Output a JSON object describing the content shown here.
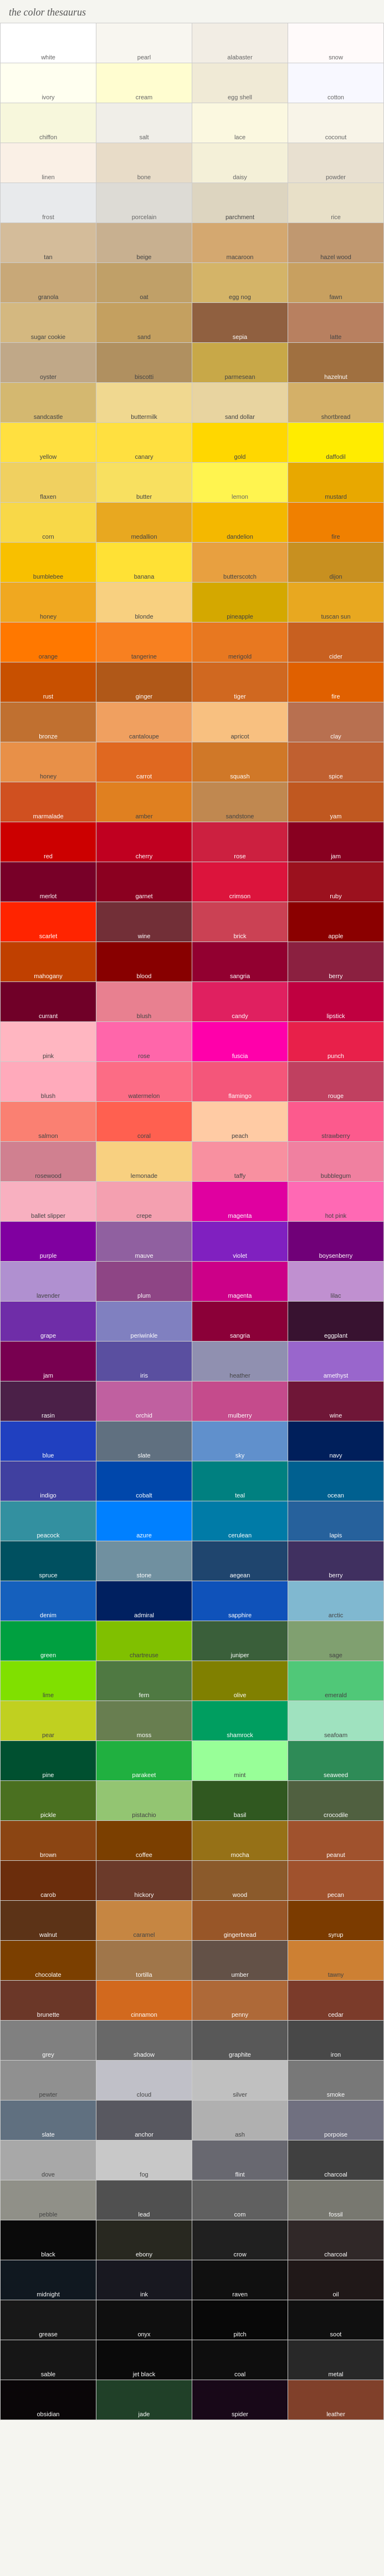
{
  "title": "the color thesaurus",
  "colors": [
    {
      "label": "white",
      "hex": "#FFFFFF"
    },
    {
      "label": "pearl",
      "hex": "#F8F6F0"
    },
    {
      "label": "alabaster",
      "hex": "#F2EDE4"
    },
    {
      "label": "snow",
      "hex": "#FFFAFA"
    },
    {
      "label": "ivory",
      "hex": "#FFFFF0"
    },
    {
      "label": "cream",
      "hex": "#FFFDD0"
    },
    {
      "label": "egg shell",
      "hex": "#F0EAD6"
    },
    {
      "label": "cotton",
      "hex": "#F8F8FF"
    },
    {
      "label": "chiffon",
      "hex": "#F7F7DC"
    },
    {
      "label": "salt",
      "hex": "#F0EEE8"
    },
    {
      "label": "lace",
      "hex": "#FBF8E0"
    },
    {
      "label": "coconut",
      "hex": "#F8F4E8"
    },
    {
      "label": "linen",
      "hex": "#FAF0E6"
    },
    {
      "label": "bone",
      "hex": "#E8DCC8"
    },
    {
      "label": "daisy",
      "hex": "#F4F0D8"
    },
    {
      "label": "powder",
      "hex": "#E8E0D0"
    },
    {
      "label": "frost",
      "hex": "#E8EAEC"
    },
    {
      "label": "porcelain",
      "hex": "#DDDBD5"
    },
    {
      "label": "parchment",
      "hex": "#DDD5C0"
    },
    {
      "label": "rice",
      "hex": "#E8E0C8"
    },
    {
      "label": "tan",
      "hex": "#D4BC9A"
    },
    {
      "label": "beige",
      "hex": "#C8B090"
    },
    {
      "label": "macaroon",
      "hex": "#D4A870"
    },
    {
      "label": "hazel wood",
      "hex": "#C09870"
    },
    {
      "label": "granola",
      "hex": "#C8A878"
    },
    {
      "label": "oat",
      "hex": "#C0A068"
    },
    {
      "label": "egg nog",
      "hex": "#D4B468"
    },
    {
      "label": "fawn",
      "hex": "#C8A060"
    },
    {
      "label": "sugar cookie",
      "hex": "#D4B880"
    },
    {
      "label": "sand",
      "hex": "#C4A060"
    },
    {
      "label": "sepia",
      "hex": "#906040"
    },
    {
      "label": "latte",
      "hex": "#B88060"
    },
    {
      "label": "oyster",
      "hex": "#C0A888"
    },
    {
      "label": "biscotti",
      "hex": "#B09060"
    },
    {
      "label": "parmesean",
      "hex": "#C8A848"
    },
    {
      "label": "hazelnut",
      "hex": "#A07040"
    },
    {
      "label": "sandcastle",
      "hex": "#D4B870"
    },
    {
      "label": "buttermilk",
      "hex": "#F0D890"
    },
    {
      "label": "sand dollar",
      "hex": "#E8D4A0"
    },
    {
      "label": "shortbread",
      "hex": "#D4B068"
    },
    {
      "label": "yellow",
      "hex": "#FFE040"
    },
    {
      "label": "canary",
      "hex": "#FFE040"
    },
    {
      "label": "gold",
      "hex": "#FFD700"
    },
    {
      "label": "daffodil",
      "hex": "#FFEC00"
    },
    {
      "label": "flaxen",
      "hex": "#F0D060"
    },
    {
      "label": "butter",
      "hex": "#F8E060"
    },
    {
      "label": "lemon",
      "hex": "#FFF44F"
    },
    {
      "label": "mustard",
      "hex": "#E8A800"
    },
    {
      "label": "corn",
      "hex": "#F8D848"
    },
    {
      "label": "medallion",
      "hex": "#E8A820"
    },
    {
      "label": "dandelion",
      "hex": "#F4B800"
    },
    {
      "label": "fire",
      "hex": "#F08000"
    },
    {
      "label": "bumblebee",
      "hex": "#F8C000"
    },
    {
      "label": "banana",
      "hex": "#FFE135"
    },
    {
      "label": "butterscotch",
      "hex": "#E8A040"
    },
    {
      "label": "dijon",
      "hex": "#C89020"
    },
    {
      "label": "honey",
      "hex": "#F0A820"
    },
    {
      "label": "blonde",
      "hex": "#F8D080"
    },
    {
      "label": "pineapple",
      "hex": "#D4A800"
    },
    {
      "label": "tuscan sun",
      "hex": "#E8A820"
    },
    {
      "label": "orange",
      "hex": "#FF7800"
    },
    {
      "label": "tangerine",
      "hex": "#F88020"
    },
    {
      "label": "merigold",
      "hex": "#E87820"
    },
    {
      "label": "cider",
      "hex": "#C86020"
    },
    {
      "label": "rust",
      "hex": "#C85000"
    },
    {
      "label": "ginger",
      "hex": "#B05818"
    },
    {
      "label": "tiger",
      "hex": "#D06820"
    },
    {
      "label": "fire",
      "hex": "#E06000"
    },
    {
      "label": "bronze",
      "hex": "#C07030"
    },
    {
      "label": "cantaloupe",
      "hex": "#F0A060"
    },
    {
      "label": "apricot",
      "hex": "#F8C080"
    },
    {
      "label": "clay",
      "hex": "#B87050"
    },
    {
      "label": "honey",
      "hex": "#E89048"
    },
    {
      "label": "carrot",
      "hex": "#E06820"
    },
    {
      "label": "squash",
      "hex": "#D07828"
    },
    {
      "label": "spice",
      "hex": "#C06030"
    },
    {
      "label": "marmalade",
      "hex": "#D05020"
    },
    {
      "label": "amber",
      "hex": "#E08020"
    },
    {
      "label": "sandstone",
      "hex": "#C08850"
    },
    {
      "label": "yam",
      "hex": "#C05820"
    },
    {
      "label": "red",
      "hex": "#CC0000"
    },
    {
      "label": "cherry",
      "hex": "#C00020"
    },
    {
      "label": "rose",
      "hex": "#CC2040"
    },
    {
      "label": "jam",
      "hex": "#880020"
    },
    {
      "label": "merlot",
      "hex": "#780028"
    },
    {
      "label": "garnet",
      "hex": "#8B0020"
    },
    {
      "label": "crimson",
      "hex": "#DC143C"
    },
    {
      "label": "ruby",
      "hex": "#9B111E"
    },
    {
      "label": "scarlet",
      "hex": "#FF2400"
    },
    {
      "label": "wine",
      "hex": "#722F37"
    },
    {
      "label": "brick",
      "hex": "#CB4154"
    },
    {
      "label": "apple",
      "hex": "#8B0000"
    },
    {
      "label": "mahogany",
      "hex": "#C04000"
    },
    {
      "label": "blood",
      "hex": "#880000"
    },
    {
      "label": "sangria",
      "hex": "#920030"
    },
    {
      "label": "berry",
      "hex": "#8B2040"
    },
    {
      "label": "currant",
      "hex": "#700028"
    },
    {
      "label": "blush",
      "hex": "#E88090"
    },
    {
      "label": "candy",
      "hex": "#E02060"
    },
    {
      "label": "lipstick",
      "hex": "#C00040"
    },
    {
      "label": "pink",
      "hex": "#FFB6C1"
    },
    {
      "label": "rose",
      "hex": "#FF66AA"
    },
    {
      "label": "fuscia",
      "hex": "#FF00AA"
    },
    {
      "label": "punch",
      "hex": "#E8204A"
    },
    {
      "label": "blush",
      "hex": "#FFAABB"
    },
    {
      "label": "watermelon",
      "hex": "#FC6C85"
    },
    {
      "label": "flamingo",
      "hex": "#F4567A"
    },
    {
      "label": "rouge",
      "hex": "#C04060"
    },
    {
      "label": "salmon",
      "hex": "#FA8072"
    },
    {
      "label": "coral",
      "hex": "#FF6050"
    },
    {
      "label": "peach",
      "hex": "#FFCBA4"
    },
    {
      "label": "strawberry",
      "hex": "#FC5A8D"
    },
    {
      "label": "rosewood",
      "hex": "#D08090"
    },
    {
      "label": "lemonade",
      "hex": "#F8D080"
    },
    {
      "label": "taffy",
      "hex": "#F890A0"
    },
    {
      "label": "bubblegum",
      "hex": "#F080A0"
    },
    {
      "label": "ballet slipper",
      "hex": "#F8B0C0"
    },
    {
      "label": "crepe",
      "hex": "#F4A0B0"
    },
    {
      "label": "magenta",
      "hex": "#E000A0"
    },
    {
      "label": "hot pink",
      "hex": "#FF69B4"
    },
    {
      "label": "purple",
      "hex": "#8000A0"
    },
    {
      "label": "mauve",
      "hex": "#9060A0"
    },
    {
      "label": "violet",
      "hex": "#8020C0"
    },
    {
      "label": "boysenberry",
      "hex": "#700078"
    },
    {
      "label": "lavender",
      "hex": "#B090D0"
    },
    {
      "label": "plum",
      "hex": "#8E4585"
    },
    {
      "label": "magenta",
      "hex": "#CC0088"
    },
    {
      "label": "lilac",
      "hex": "#C090D0"
    },
    {
      "label": "grape",
      "hex": "#6F2DA8"
    },
    {
      "label": "periwinkle",
      "hex": "#8080C0"
    },
    {
      "label": "sangria",
      "hex": "#8B0038"
    },
    {
      "label": "eggplant",
      "hex": "#381230"
    },
    {
      "label": "jam",
      "hex": "#780050"
    },
    {
      "label": "iris",
      "hex": "#5A4FA0"
    },
    {
      "label": "heather",
      "hex": "#9090B0"
    },
    {
      "label": "amethyst",
      "hex": "#9966CC"
    },
    {
      "label": "rasin",
      "hex": "#4B2048"
    },
    {
      "label": "orchid",
      "hex": "#C060A0"
    },
    {
      "label": "mulberry",
      "hex": "#C54B8C"
    },
    {
      "label": "wine",
      "hex": "#6F1637"
    },
    {
      "label": "blue",
      "hex": "#2040C0"
    },
    {
      "label": "slate",
      "hex": "#607080"
    },
    {
      "label": "sky",
      "hex": "#6090CC"
    },
    {
      "label": "navy",
      "hex": "#001F5B"
    },
    {
      "label": "indigo",
      "hex": "#4040A0"
    },
    {
      "label": "cobalt",
      "hex": "#0047AB"
    },
    {
      "label": "teal",
      "hex": "#008080"
    },
    {
      "label": "ocean",
      "hex": "#006090"
    },
    {
      "label": "peacock",
      "hex": "#3390A0"
    },
    {
      "label": "azure",
      "hex": "#0080FF"
    },
    {
      "label": "cerulean",
      "hex": "#007BA7"
    },
    {
      "label": "lapis",
      "hex": "#26619C"
    },
    {
      "label": "spruce",
      "hex": "#005060"
    },
    {
      "label": "stone",
      "hex": "#7090A0"
    },
    {
      "label": "aegean",
      "hex": "#1F456E"
    },
    {
      "label": "berry",
      "hex": "#403060"
    },
    {
      "label": "denim",
      "hex": "#1560BD"
    },
    {
      "label": "admiral",
      "hex": "#002060"
    },
    {
      "label": "sapphire",
      "hex": "#0F52BA"
    },
    {
      "label": "arctic",
      "hex": "#80B8D0"
    },
    {
      "label": "green",
      "hex": "#00A040"
    },
    {
      "label": "chartreuse",
      "hex": "#80C000"
    },
    {
      "label": "juniper",
      "hex": "#3A5F3A"
    },
    {
      "label": "sage",
      "hex": "#80A070"
    },
    {
      "label": "lime",
      "hex": "#80E000"
    },
    {
      "label": "fern",
      "hex": "#4F7942"
    },
    {
      "label": "olive",
      "hex": "#808000"
    },
    {
      "label": "emerald",
      "hex": "#50C878"
    },
    {
      "label": "pear",
      "hex": "#C0D020"
    },
    {
      "label": "moss",
      "hex": "#687E50"
    },
    {
      "label": "shamrock",
      "hex": "#009E60"
    },
    {
      "label": "seafoam",
      "hex": "#9FE2BF"
    },
    {
      "label": "pine",
      "hex": "#005030"
    },
    {
      "label": "parakeet",
      "hex": "#20B040"
    },
    {
      "label": "mint",
      "hex": "#98FF98"
    },
    {
      "label": "seaweed",
      "hex": "#2E8B57"
    },
    {
      "label": "pickle",
      "hex": "#4A7020"
    },
    {
      "label": "pistachio",
      "hex": "#93C572"
    },
    {
      "label": "basil",
      "hex": "#305820"
    },
    {
      "label": "crocodile",
      "hex": "#506040"
    },
    {
      "label": "brown",
      "hex": "#8B4513"
    },
    {
      "label": "coffee",
      "hex": "#7B3F00"
    },
    {
      "label": "mocha",
      "hex": "#967117"
    },
    {
      "label": "peanut",
      "hex": "#A0522D"
    },
    {
      "label": "carob",
      "hex": "#6B2D0C"
    },
    {
      "label": "hickory",
      "hex": "#6B3A2A"
    },
    {
      "label": "wood",
      "hex": "#8B5A2B"
    },
    {
      "label": "pecan",
      "hex": "#A0522D"
    },
    {
      "label": "walnut",
      "hex": "#5C3317"
    },
    {
      "label": "caramel",
      "hex": "#C68642"
    },
    {
      "label": "gingerbread",
      "hex": "#985628"
    },
    {
      "label": "syrup",
      "hex": "#7B3B00"
    },
    {
      "label": "chocolate",
      "hex": "#7B3F00"
    },
    {
      "label": "tortilla",
      "hex": "#A0764A"
    },
    {
      "label": "umber",
      "hex": "#635147"
    },
    {
      "label": "tawny",
      "hex": "#CD8033"
    },
    {
      "label": "brunette",
      "hex": "#6B3728"
    },
    {
      "label": "cinnamon",
      "hex": "#D2691E"
    },
    {
      "label": "penny",
      "hex": "#AE6938"
    },
    {
      "label": "cedar",
      "hex": "#7B3B2A"
    },
    {
      "label": "grey",
      "hex": "#808080"
    },
    {
      "label": "shadow",
      "hex": "#686868"
    },
    {
      "label": "graphite",
      "hex": "#585858"
    },
    {
      "label": "iron",
      "hex": "#484848"
    },
    {
      "label": "pewter",
      "hex": "#909090"
    },
    {
      "label": "cloud",
      "hex": "#C0C0C8"
    },
    {
      "label": "silver",
      "hex": "#C0C0C0"
    },
    {
      "label": "smoke",
      "hex": "#787878"
    },
    {
      "label": "slate",
      "hex": "#607080"
    },
    {
      "label": "anchor",
      "hex": "#585860"
    },
    {
      "label": "ash",
      "hex": "#B0B0B0"
    },
    {
      "label": "porpoise",
      "hex": "#707080"
    },
    {
      "label": "dove",
      "hex": "#A8A8A8"
    },
    {
      "label": "fog",
      "hex": "#C8C8C8"
    },
    {
      "label": "flint",
      "hex": "#686870"
    },
    {
      "label": "charcoal",
      "hex": "#404040"
    },
    {
      "label": "pebble",
      "hex": "#909088"
    },
    {
      "label": "lead",
      "hex": "#505050"
    },
    {
      "label": "com",
      "hex": "#606060"
    },
    {
      "label": "fossil",
      "hex": "#787870"
    },
    {
      "label": "black",
      "hex": "#0A0A0A"
    },
    {
      "label": "ebony",
      "hex": "#282820"
    },
    {
      "label": "crow",
      "hex": "#202020"
    },
    {
      "label": "charcoal",
      "hex": "#302828"
    },
    {
      "label": "midnight",
      "hex": "#101820"
    },
    {
      "label": "ink",
      "hex": "#181820"
    },
    {
      "label": "raven",
      "hex": "#101010"
    },
    {
      "label": "oil",
      "hex": "#201818"
    },
    {
      "label": "grease",
      "hex": "#181818"
    },
    {
      "label": "onyx",
      "hex": "#0F0F0F"
    },
    {
      "label": "pitch",
      "hex": "#080808"
    },
    {
      "label": "soot",
      "hex": "#101010"
    },
    {
      "label": "sable",
      "hex": "#161616"
    },
    {
      "label": "jet black",
      "hex": "#0A0A0A"
    },
    {
      "label": "coal",
      "hex": "#0E0E0E"
    },
    {
      "label": "metal",
      "hex": "#282828"
    },
    {
      "label": "obsidian",
      "hex": "#0A0608"
    },
    {
      "label": "jade",
      "hex": "#204028"
    },
    {
      "label": "spider",
      "hex": "#180818"
    },
    {
      "label": "leather",
      "hex": "#80402A"
    }
  ]
}
